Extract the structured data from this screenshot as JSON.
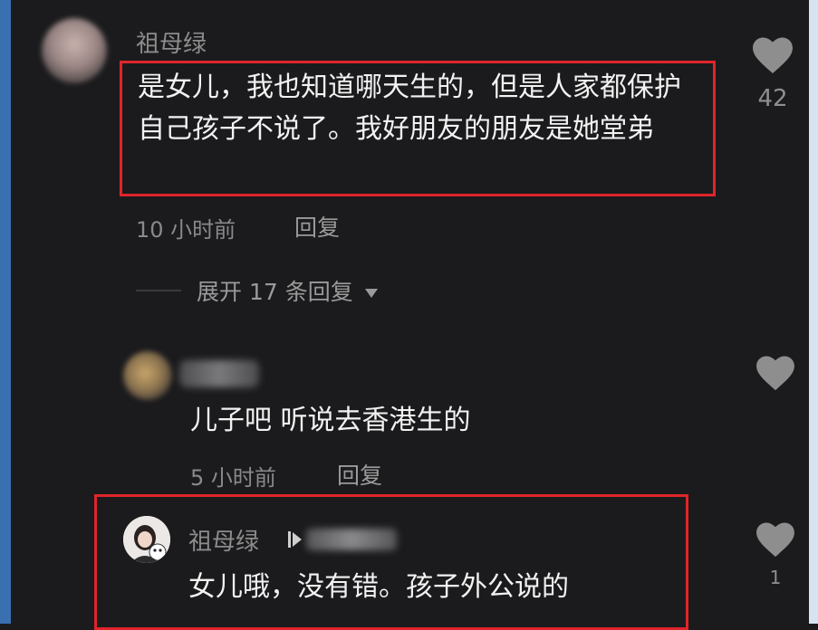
{
  "comment1": {
    "username": "祖母绿",
    "text": "是女儿，我也知道哪天生的，但是人家都保护自己孩子不说了。我好朋友的朋友是她堂弟",
    "time": "10 小时前",
    "reply_label": "回复",
    "like_count": "42",
    "expand_label": "展开 17 条回复"
  },
  "comment2": {
    "text": "儿子吧 听说去香港生的",
    "time": "5 小时前",
    "reply_label": "回复"
  },
  "comment3": {
    "username": "祖母绿",
    "text": "女儿哦，没有错。孩子外公说的",
    "like_count": "1"
  },
  "icons": {
    "like": "heart-icon",
    "expand": "caret-down-icon",
    "author_badge": "play-icon"
  },
  "colors": {
    "highlight": "#e0242b",
    "background": "#1b1b1d"
  }
}
